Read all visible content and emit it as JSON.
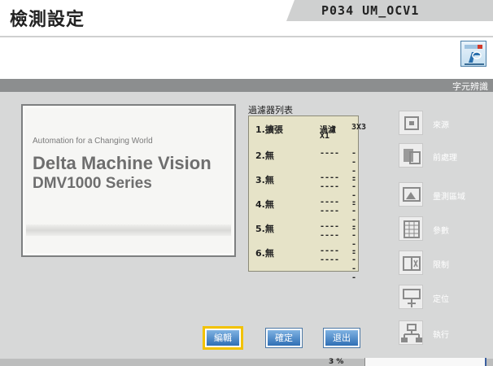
{
  "header": {
    "title": "檢測設定",
    "program_id": "P034 UM_OCV1",
    "app_icon": "camera-report-icon"
  },
  "band": {
    "label": "字元辨識"
  },
  "preview": {
    "line1": "Automation for a Changing World",
    "line2": "Delta Machine Vision",
    "line3": "DMV1000 Series"
  },
  "filter": {
    "title": "過濾器列表",
    "rows": [
      {
        "num": "1.擴張",
        "c1": "過濾",
        "c2": "X1",
        "c3": "3X3"
      },
      {
        "num": "2.無",
        "c1": "----",
        "c2": "",
        "c3": "----"
      },
      {
        "num": "3.無",
        "c1": "----",
        "c2": "----",
        "c3": "----"
      },
      {
        "num": "4.無",
        "c1": "----",
        "c2": "----",
        "c3": "----"
      },
      {
        "num": "5.無",
        "c1": "----",
        "c2": "----",
        "c3": "----"
      },
      {
        "num": "6.無",
        "c1": "----",
        "c2": "----",
        "c3": "----"
      }
    ]
  },
  "sidebar": {
    "items": [
      {
        "label": "來源",
        "icon": "source-camera-icon"
      },
      {
        "label": "前處理",
        "icon": "preprocess-icon"
      },
      {
        "label": "量測區域",
        "icon": "measure-area-icon"
      },
      {
        "label": "參數",
        "icon": "parameter-grid-icon"
      },
      {
        "label": "限制",
        "icon": "limit-icon"
      },
      {
        "label": "定位",
        "icon": "position-icon"
      },
      {
        "label": "執行",
        "icon": "execute-icon"
      }
    ]
  },
  "buttons": {
    "edit": "編輯",
    "confirm": "確定",
    "exit": "退出"
  },
  "status": {
    "text": "3 %"
  },
  "colors": {
    "band": "#8c8e8f",
    "button": "#2f6fb5",
    "selected": "#f2c200",
    "filter_bg": "#e6e3c8"
  }
}
